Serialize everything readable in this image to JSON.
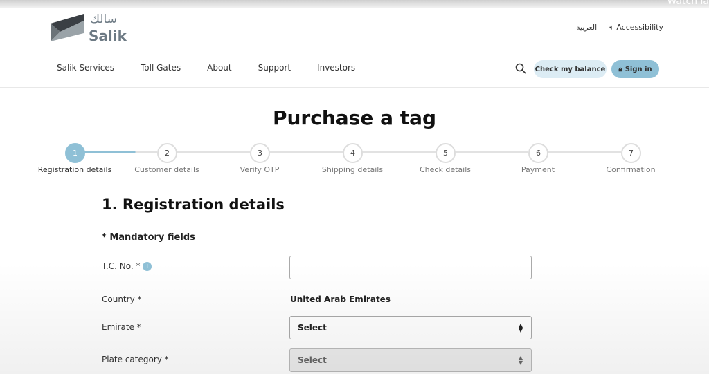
{
  "overlay": {
    "watch_text": "Watch la"
  },
  "header": {
    "logo_en": "Salik",
    "logo_ar": "سالك",
    "lang": "العربية",
    "accessibility": "Accessibility"
  },
  "nav": {
    "items": [
      "Salik Services",
      "Toll Gates",
      "About",
      "Support",
      "Investors"
    ],
    "check_balance": "Check my balance",
    "sign_in": "Sign in"
  },
  "page": {
    "title": "Purchase a tag"
  },
  "stepper": {
    "current": 1,
    "steps": [
      {
        "num": "1",
        "label": "Registration details"
      },
      {
        "num": "2",
        "label": "Customer details"
      },
      {
        "num": "3",
        "label": "Verify OTP"
      },
      {
        "num": "4",
        "label": "Shipping details"
      },
      {
        "num": "5",
        "label": "Check details"
      },
      {
        "num": "6",
        "label": "Payment"
      },
      {
        "num": "7",
        "label": "Confirmation"
      }
    ]
  },
  "form": {
    "heading": "1. Registration details",
    "mandatory": "* Mandatory fields",
    "tc_label": "T.C. No. *",
    "tc_value": "",
    "country_label": "Country *",
    "country_value": "United Arab Emirates",
    "emirate_label": "Emirate *",
    "emirate_value": "Select",
    "plate_label": "Plate category *",
    "plate_value": "Select"
  },
  "colors": {
    "accent": "#8fc0d6",
    "accent_light": "#dcecf4"
  }
}
